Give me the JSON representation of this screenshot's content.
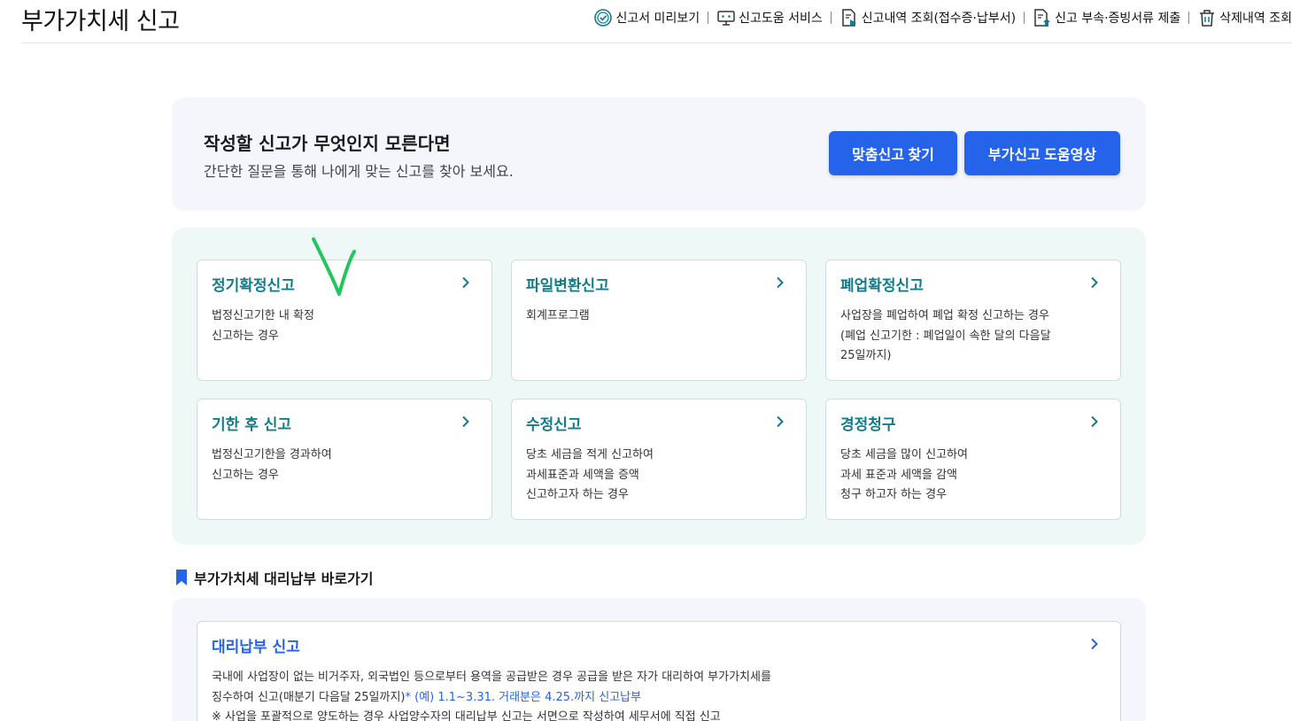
{
  "header": {
    "title": "부가가치세 신고",
    "menu": [
      {
        "label": "신고서 미리보기",
        "icon": "check-circle-icon"
      },
      {
        "label": "신고도움 서비스",
        "icon": "monitor-help-icon"
      },
      {
        "label": "신고내역 조회(접수증·납부서)",
        "icon": "document-search-icon"
      },
      {
        "label": "신고 부속·증빙서류 제출",
        "icon": "document-upload-icon"
      },
      {
        "label": "삭제내역 조회",
        "icon": "trash-icon"
      }
    ]
  },
  "banner": {
    "title": "작성할 신고가 무엇인지 모른다면",
    "subtitle": "간단한 질문을 통해 나에게 맞는 신고를 찾아 보세요.",
    "find_button": "맞춤신고 찾기",
    "video_button": "부가신고 도움영상"
  },
  "cards": [
    {
      "title": "정기확정신고",
      "desc": [
        "법정신고기한 내 확정",
        "신고하는 경우"
      ]
    },
    {
      "title": "파일변환신고",
      "desc": [
        "회계프로그램"
      ]
    },
    {
      "title": "폐업확정신고",
      "desc": [
        "사업장을 폐업하여 폐업 확정 신고하는 경우",
        "(폐업 신고기한 : 폐업일이 속한 달의 다음달",
        "25일까지)"
      ]
    },
    {
      "title": "기한 후 신고",
      "desc": [
        "법정신고기한을 경과하여",
        "신고하는 경우"
      ]
    },
    {
      "title": "수정신고",
      "desc": [
        "당초 세금을 적게 신고하여",
        "과세표준과 세액을 증액",
        "신고하고자 하는 경우"
      ]
    },
    {
      "title": "경정청구",
      "desc": [
        "당초 세금을 많이 신고하여",
        "과세 표준과 세액을 감액",
        "청구 하고자 하는 경우"
      ]
    }
  ],
  "proxy_section": {
    "heading": "부가가치세 대리납부 바로가기",
    "card_title": "대리납부 신고",
    "desc_line1": "국내에 사업장이 없는 비거주자, 외국법인 등으로부터 용역을 공급받은 경우 공급을 받은 자가 대리하여 부가가치세를",
    "desc_line2_a": "징수하여 신고(매분기 다음달 25일까지)",
    "desc_line2_b": "* (예) 1.1~3.31. 거래분은 4.25.까지 신고납부",
    "desc_line3": "※ 사업을 포괄적으로 양도하는 경우 사업양수자의 대리납부 신고는 서면으로 작성하여 세무서에 직접 신고"
  },
  "colors": {
    "primary_blue": "#2563eb",
    "teal_title": "#137c8b",
    "panel_mint": "#eef8f6",
    "panel_gray": "#f4f6fb",
    "scribble_green": "#22c55e"
  }
}
